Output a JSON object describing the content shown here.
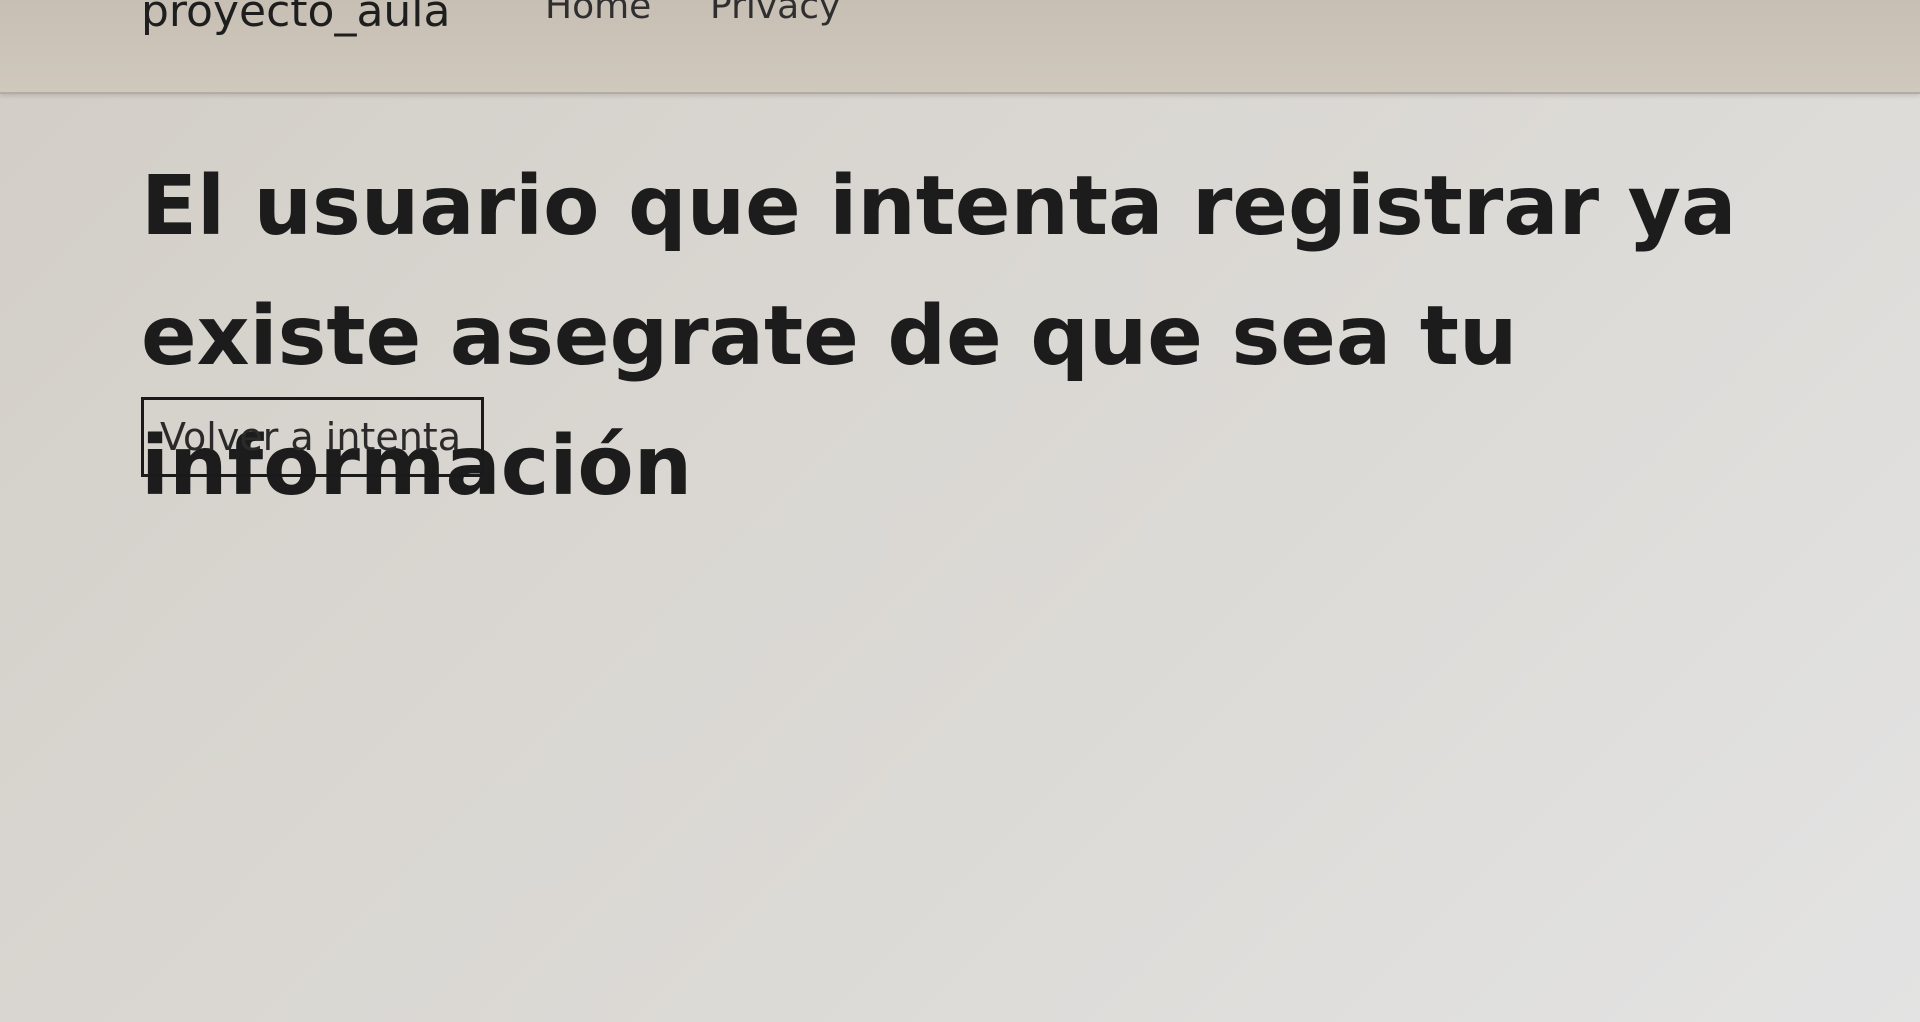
{
  "navbar": {
    "brand": "proyecto_aula",
    "links": [
      {
        "label": "Home"
      },
      {
        "label": "Privacy"
      }
    ]
  },
  "main": {
    "message": "El usuario que intenta registrar ya existe asegrate de que sea tu información",
    "retry_button_label": "Volver a intenta"
  }
}
